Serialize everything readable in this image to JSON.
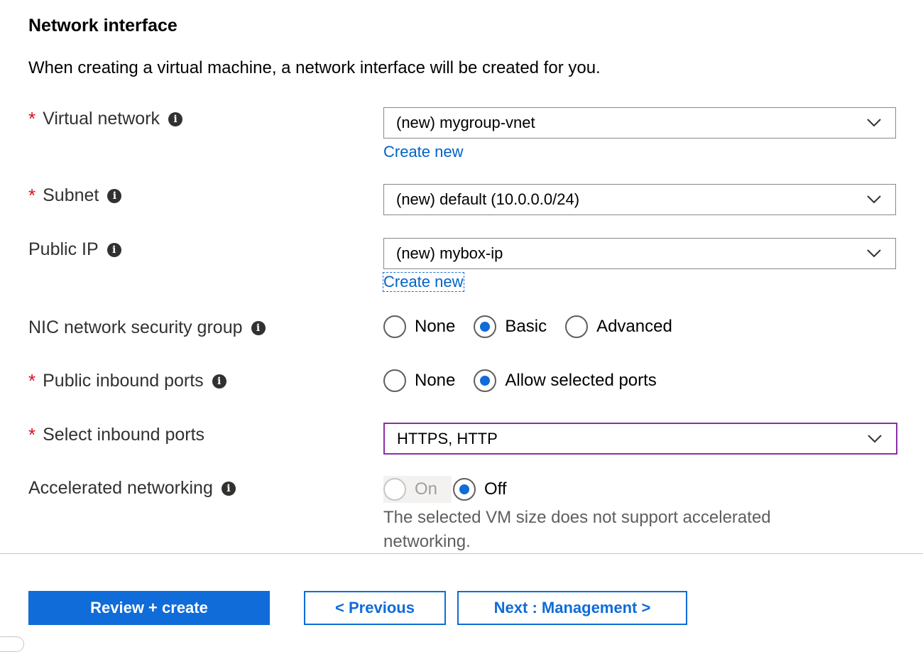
{
  "section": {
    "title": "Network interface",
    "description": "When creating a virtual machine, a network interface will be created for you."
  },
  "fields": {
    "virtual_network": {
      "label": "Virtual network",
      "required": "*",
      "value": "(new) mygroup-vnet",
      "create_link": "Create new"
    },
    "subnet": {
      "label": "Subnet",
      "required": "*",
      "value": "(new) default (10.0.0.0/24)"
    },
    "public_ip": {
      "label": "Public IP",
      "value": "(new) mybox-ip",
      "create_link": "Create new"
    },
    "nic_nsg": {
      "label": "NIC network security group",
      "options": [
        "None",
        "Basic",
        "Advanced"
      ],
      "selected": "Basic"
    },
    "public_inbound_ports": {
      "label": "Public inbound ports",
      "required": "*",
      "options": [
        "None",
        "Allow selected ports"
      ],
      "selected": "Allow selected ports"
    },
    "select_inbound_ports": {
      "label": "Select inbound ports",
      "required": "*",
      "value": "HTTPS, HTTP"
    },
    "accelerated_networking": {
      "label": "Accelerated networking",
      "options": [
        "On",
        "Off"
      ],
      "selected": "Off",
      "disabled_option": "On",
      "note": "The selected VM size does not support accelerated networking."
    }
  },
  "info_icon_glyph": "i",
  "footer": {
    "review_create": "Review + create",
    "previous": "< Previous",
    "next": "Next : Management >"
  },
  "colors": {
    "accent": "#0f6cd8",
    "required": "#e00b1c",
    "focus_border": "#8b2fa8",
    "link": "#0063c8"
  }
}
